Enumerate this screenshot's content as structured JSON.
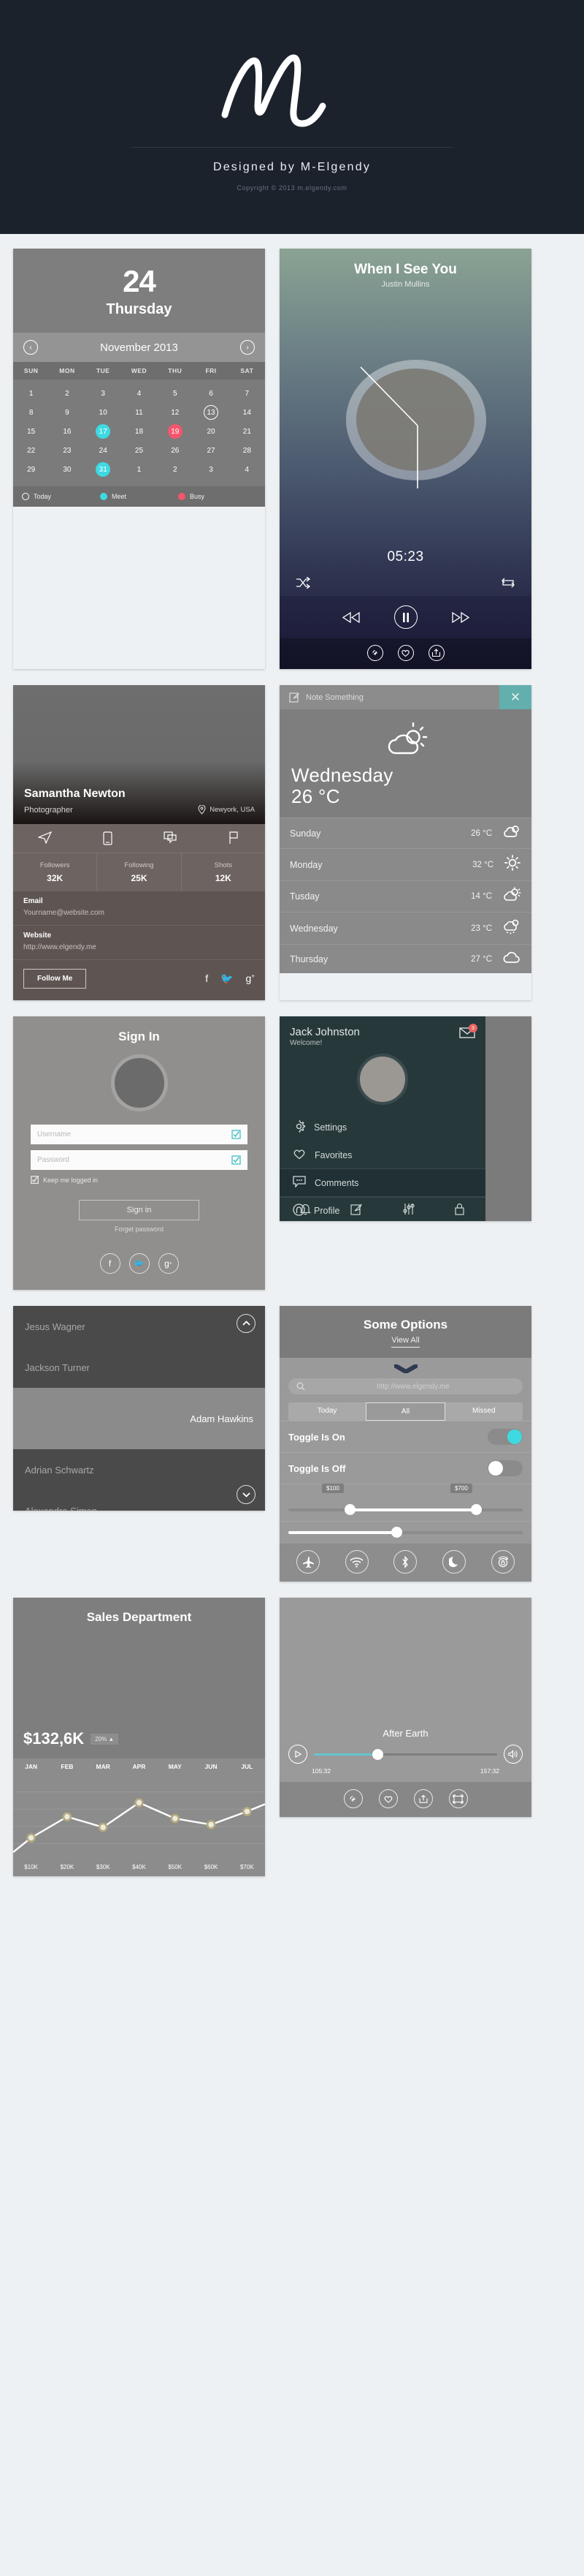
{
  "hero": {
    "logo_icon": "m-signature-logo",
    "title": "Designed by M-Elgendy",
    "copyright": "Copyright © 2013 m.elgendy.com"
  },
  "calendar": {
    "day_number": "24",
    "day_name": "Thursday",
    "month_label": "November 2013",
    "prev_icon": "chevron-left-icon",
    "next_icon": "chevron-right-icon",
    "weekdays": [
      "SUN",
      "MON",
      "TUE",
      "WED",
      "THU",
      "FRI",
      "SAT"
    ],
    "weeks": [
      [
        {
          "d": "1"
        },
        {
          "d": "2"
        },
        {
          "d": "3"
        },
        {
          "d": "4"
        },
        {
          "d": "5"
        },
        {
          "d": "6"
        },
        {
          "d": "7"
        }
      ],
      [
        {
          "d": "8"
        },
        {
          "d": "9"
        },
        {
          "d": "10"
        },
        {
          "d": "11"
        },
        {
          "d": "12"
        },
        {
          "d": "13",
          "s": "today"
        },
        {
          "d": "14"
        }
      ],
      [
        {
          "d": "15"
        },
        {
          "d": "16"
        },
        {
          "d": "17",
          "s": "meet"
        },
        {
          "d": "18"
        },
        {
          "d": "19",
          "s": "busy"
        },
        {
          "d": "20"
        },
        {
          "d": "21"
        }
      ],
      [
        {
          "d": "22"
        },
        {
          "d": "23"
        },
        {
          "d": "24"
        },
        {
          "d": "25"
        },
        {
          "d": "26"
        },
        {
          "d": "27"
        },
        {
          "d": "28"
        }
      ],
      [
        {
          "d": "29"
        },
        {
          "d": "30"
        },
        {
          "d": "31",
          "s": "meet"
        },
        {
          "d": "1"
        },
        {
          "d": "2"
        },
        {
          "d": "3"
        },
        {
          "d": "4"
        }
      ]
    ],
    "legend": [
      {
        "label": "Today",
        "type": "outline"
      },
      {
        "label": "Meet",
        "type": "meet"
      },
      {
        "label": "Busy",
        "type": "busy"
      }
    ],
    "colors": {
      "meet": "#3fd9e2",
      "busy": "#f4566b"
    }
  },
  "music": {
    "title": "When I See You",
    "artist": "Justin Mullins",
    "elapsed": "05:23",
    "shuffle_icon": "shuffle-icon",
    "repeat_icon": "repeat-icon",
    "prev_icon": "rewind-icon",
    "play_icon": "pause-icon",
    "next_icon": "fast-forward-icon",
    "bottom_icons": [
      "link-icon",
      "heart-icon",
      "share-icon"
    ]
  },
  "profile": {
    "name": "Samantha Newton",
    "job": "Photographer",
    "location": "Newyork, USA",
    "location_icon": "map-pin-icon",
    "action_icons": [
      "send-icon",
      "phone-icon",
      "chat-icon",
      "flag-icon"
    ],
    "stats": [
      {
        "label": "Followers",
        "value": "32K"
      },
      {
        "label": "Following",
        "value": "25K"
      },
      {
        "label": "Shots",
        "value": "12K"
      }
    ],
    "fields": [
      {
        "label": "Email",
        "value": "Yourname@website.com"
      },
      {
        "label": "Website",
        "value": "http://www.elgendy.me"
      }
    ],
    "follow_label": "Follow Me",
    "social_icons": [
      "facebook-icon",
      "twitter-icon",
      "googleplus-icon"
    ]
  },
  "weather": {
    "note_label": "Note Something",
    "note_icon": "compose-icon",
    "close_icon": "close-icon",
    "today_icon": "sun-cloud-icon",
    "today_day": "Wednesday",
    "today_temp": "26 °C",
    "forecast": [
      {
        "day": "Sunday",
        "temp": "26 °C",
        "icon": "cloud-sun-icon"
      },
      {
        "day": "Monday",
        "temp": "32 °C",
        "icon": "sun-icon"
      },
      {
        "day": "Tusday",
        "temp": "14 °C",
        "icon": "sun-cloud-icon"
      },
      {
        "day": "Wednesday",
        "temp": "23 °C",
        "icon": "cloud-snow-icon"
      },
      {
        "day": "Thursday",
        "temp": "27 °C",
        "icon": "cloud-icon"
      }
    ],
    "accent": "#62afae"
  },
  "signin": {
    "title": "Sign In",
    "avatar_icon": "avatar-placeholder",
    "username_placeholder": "Username",
    "password_placeholder": "Password",
    "field_icon": "checkbox-icon",
    "keep_logged_label": "Keep me logged in",
    "submit_label": "Sign in",
    "forgot_label": "Forget password",
    "social_icons": [
      "facebook-icon",
      "twitter-icon",
      "googleplus-icon"
    ]
  },
  "sidemenu": {
    "name": "Jack Johnston",
    "welcome": "Welcome!",
    "mail_icon": "envelope-icon",
    "badge": "3",
    "avatar_icon": "avatar-placeholder",
    "items": [
      {
        "label": "Settings",
        "icon": "gear-icon",
        "selected": false
      },
      {
        "label": "Favorites",
        "icon": "heart-icon",
        "selected": false
      },
      {
        "label": "Comments",
        "icon": "comment-icon",
        "selected": true
      },
      {
        "label": "Profile",
        "icon": "user-icon",
        "selected": false
      }
    ],
    "nav_icons": [
      "bell-icon",
      "compose-icon",
      "sliders-icon",
      "lock-icon"
    ],
    "accent": "#27383b"
  },
  "contacts": {
    "collapse_icon": "chevron-up-circle-icon",
    "expand_icon": "chevron-down-circle-icon",
    "items": [
      {
        "name": "Jesus Wagner",
        "highlight": false
      },
      {
        "name": "Jackson Turner",
        "highlight": false
      },
      {
        "name": "Adam Hawkins",
        "highlight": true
      },
      {
        "name": "Adrian Schwartz",
        "highlight": false
      },
      {
        "name": "Alexandra Simon",
        "highlight": false
      }
    ]
  },
  "options": {
    "title": "Some Options",
    "view_all": "View All",
    "chevron_icon": "chevron-down-icon",
    "search_icon": "search-icon",
    "search_value": "http://www.elgendy.me",
    "segments": [
      {
        "label": "Today",
        "active": false
      },
      {
        "label": "All",
        "active": true
      },
      {
        "label": "Missed",
        "active": false
      }
    ],
    "toggles": [
      {
        "label": "Toggle Is On",
        "state": "on"
      },
      {
        "label": "Toggle Is Off",
        "state": "off"
      }
    ],
    "range_slider": {
      "min_label": "$100",
      "max_label": "$700",
      "min_pct": 25,
      "max_pct": 80
    },
    "single_slider": {
      "value_pct": 46
    },
    "quick_icons": [
      "airplane-icon",
      "wifi-icon",
      "bluetooth-icon",
      "moon-icon",
      "rotation-lock-icon"
    ],
    "accent": "#3fd9e2"
  },
  "sales": {
    "title": "Sales Department",
    "total": "$132,6K",
    "change": "20% ▲"
  },
  "chart_data": {
    "type": "line",
    "title": "Sales Department",
    "categories": [
      "JAN",
      "FEB",
      "MAR",
      "APR",
      "MAY",
      "JUN",
      "JUL"
    ],
    "x_tick_labels": [
      "$10K",
      "$20K",
      "$30K",
      "$40K",
      "$50K",
      "$60K",
      "$70K"
    ],
    "values": [
      18,
      42,
      30,
      58,
      40,
      33,
      48
    ],
    "ylim": [
      0,
      80
    ],
    "xlabel": "",
    "ylabel": "",
    "grid": true,
    "legend": "none",
    "point_color": "#cbbf96",
    "line_color": "#ffffff"
  },
  "video": {
    "title": "After Earth",
    "play_icon": "play-circle-icon",
    "volume_icon": "volume-icon",
    "elapsed": "105:32",
    "duration": "157:32",
    "progress_pct": 34,
    "bottom_icons": [
      "link-icon",
      "heart-icon",
      "share-icon",
      "fullscreen-icon"
    ],
    "accent": "#63c6cc"
  }
}
